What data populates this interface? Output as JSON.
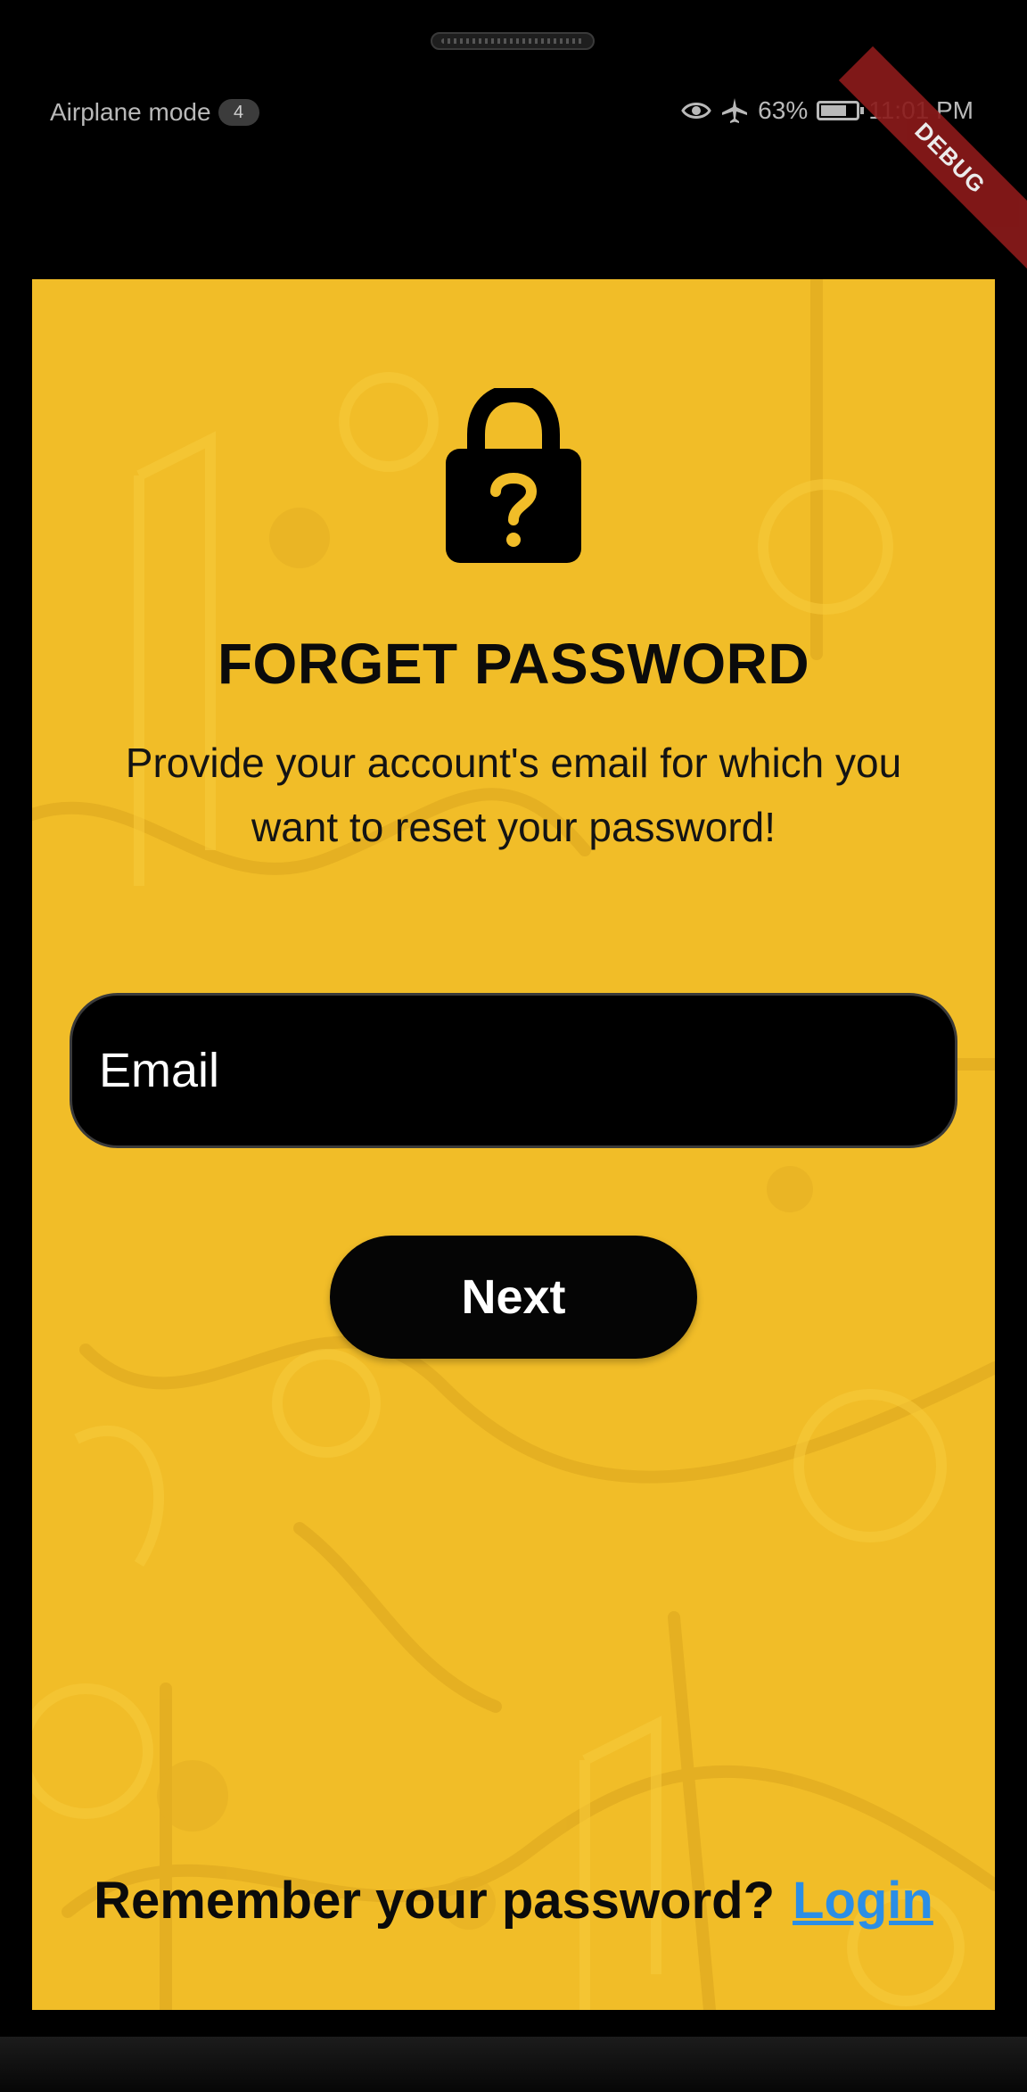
{
  "status_bar": {
    "mode_text": "Airplane mode",
    "notification_count": "4",
    "battery_text": "63%",
    "time": "11:01 PM",
    "icons": [
      "eye-icon",
      "airplane-icon",
      "battery-charging-icon"
    ]
  },
  "debug_banner": "DEBUG",
  "forgot_password": {
    "title": "FORGET PASSWORD",
    "subtitle": "Provide your account's email for which you want to reset your password!",
    "email_placeholder": "Email",
    "email_value": "",
    "next_label": "Next",
    "remember_text": "Remember your password?",
    "login_label": "Login"
  },
  "colors": {
    "background_yellow": "#f1bd28",
    "button_black": "#050505",
    "link_blue": "#2b8ee6",
    "debug_red": "#8a1a1a"
  }
}
